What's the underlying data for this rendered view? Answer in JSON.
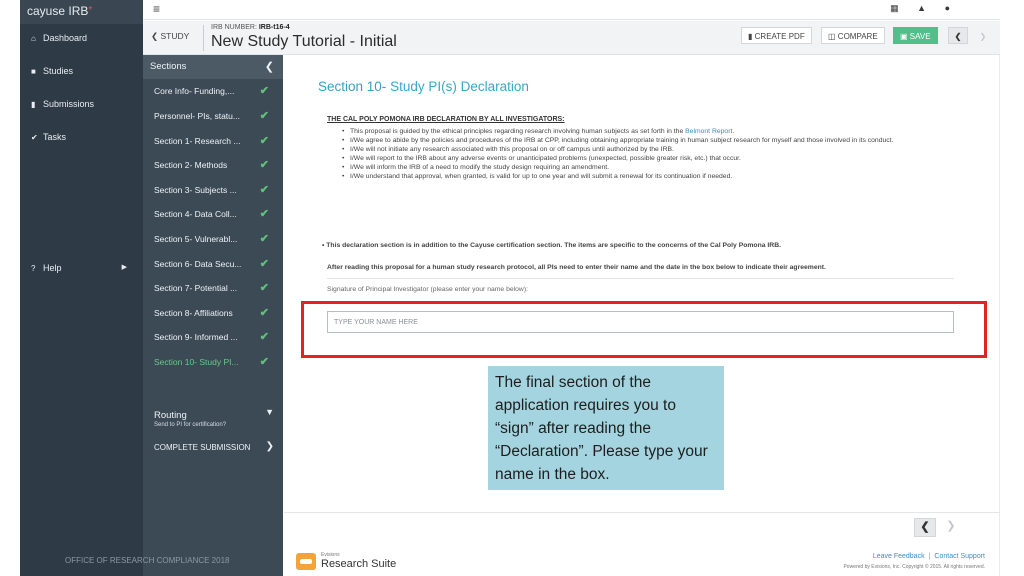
{
  "app": {
    "brand": "cayuse IRB",
    "brand_mark": "*"
  },
  "nav": {
    "items": [
      {
        "label": "Dashboard",
        "icon": "home-icon"
      },
      {
        "label": "Studies",
        "icon": "folder-icon"
      },
      {
        "label": "Submissions",
        "icon": "document-icon"
      },
      {
        "label": "Tasks",
        "icon": "check-icon"
      }
    ],
    "help": "Help"
  },
  "topbar": {
    "icons": [
      "grid-icon",
      "bell-icon",
      "user-icon"
    ]
  },
  "study": {
    "back_label": "STUDY",
    "irb_label": "IRB NUMBER:",
    "irb_number": "IRB-t16-4",
    "title": "New Study Tutorial - Initial",
    "create_pdf": "CREATE PDF",
    "compare": "COMPARE",
    "save": "SAVE"
  },
  "sections": {
    "header": "Sections",
    "items": [
      {
        "label": "Core Info- Funding,...",
        "complete": true
      },
      {
        "label": "Personnel- PIs, statu...",
        "complete": true
      },
      {
        "label": "Section 1- Research ...",
        "complete": true
      },
      {
        "label": "Section 2- Methods",
        "complete": true
      },
      {
        "label": "Section 3- Subjects ...",
        "complete": true
      },
      {
        "label": "Section 4- Data Coll...",
        "complete": true
      },
      {
        "label": "Section 5- Vulnerabl...",
        "complete": true
      },
      {
        "label": "Section 6- Data Secu...",
        "complete": true
      },
      {
        "label": "Section 7- Potential ...",
        "complete": true
      },
      {
        "label": "Section 8- Affiliations",
        "complete": true
      },
      {
        "label": "Section 9- Informed ...",
        "complete": true
      },
      {
        "label": "Section 10- Study PI...",
        "complete": true,
        "active": true
      }
    ],
    "routing_title": "Routing",
    "routing_sub": "Send to PI for certification?",
    "complete_submission": "COMPLETE SUBMISSION"
  },
  "main": {
    "section_number": "Section 10-",
    "section_name": "Study PI(s) Declaration",
    "declaration_heading": "THE CAL POLY POMONA IRB DECLARATION BY ALL INVESTIGATORS:",
    "bullet_1_pre": "This proposal is guided by the ethical principles regarding research involving human subjects as set forth in the",
    "bullet_1_link": "Belmont Report",
    "bullet_1_post": ".",
    "bullet_2": "I/We agree to abide by the policies and procedures of the IRB at CPP, including obtaining appropriate training in human subject research for myself and those involved in its conduct.",
    "bullet_3": "I/We will not initiate any research associated with this proposal on or off campus until authorized by the IRB.",
    "bullet_4": "I/We will report to the IRB about any adverse events or unanticipated problems (unexpected, possible greater risk, etc.) that occur.",
    "bullet_5": "I/We will inform the IRB of a need to modify the study design requiring an amendment.",
    "bullet_6": "I/We understand that approval, when granted, is valid for up to one year and will submit a renewal for its continuation if needed.",
    "note_1": "• This declaration section is in addition to the Cayuse certification section. The items are specific to the concerns of the Cal Poly Pomona IRB.",
    "note_2": "After reading this proposal for a human study research protocol, all PIs need to enter their name and the date in the box below to indicate their agreement.",
    "signature_label": "Signature of Principal Investigator (please enter your name below):",
    "signature_placeholder": "TYPE YOUR NAME HERE",
    "signature_value": ""
  },
  "callout": {
    "text": "The final section of the application requires you to “sign” after reading the “Declaration”. Please type your name in the box."
  },
  "footer": {
    "logo_small": "Evisions",
    "logo_big": "Research Suite",
    "leave_feedback": "Leave Feedback",
    "separator": "|",
    "contact_support": "Contact Support",
    "copyright": "Powered by Evisions, Inc. Copyright © 2015. All rights reserved.",
    "compliance": "OFFICE OF RESEARCH COMPLIANCE 2018"
  },
  "colors": {
    "nav_bg": "#2e3a46",
    "sections_bg": "#3c4a56",
    "accent_teal": "#3aa7c9",
    "save_green": "#52bf8a",
    "check_green": "#62c07a",
    "highlight_red": "#e32222",
    "callout_bg": "#a3d4df"
  }
}
